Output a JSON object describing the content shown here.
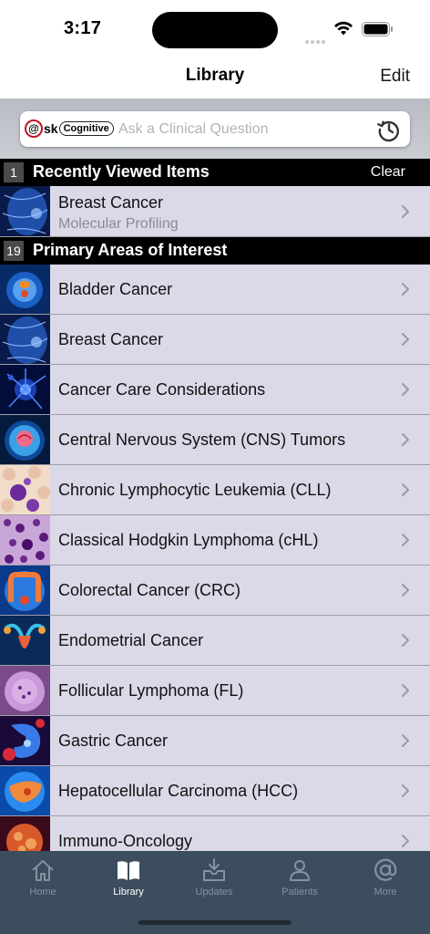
{
  "status_bar": {
    "time": "3:17"
  },
  "navbar": {
    "title": "Library",
    "edit_label": "Edit"
  },
  "search": {
    "logo_at": "@",
    "logo_sk": "sk",
    "logo_cognitive": "Cognitive",
    "placeholder": "Ask a Clinical Question",
    "history_icon": "history-clock-icon"
  },
  "recent": {
    "count": "1",
    "title": "Recently Viewed Items",
    "clear_label": "Clear",
    "items": [
      {
        "title": "Breast Cancer",
        "subtitle": "Molecular Profiling",
        "thumb": "breast-scan"
      }
    ]
  },
  "primary": {
    "count": "19",
    "title": "Primary Areas of Interest",
    "items": [
      {
        "title": "Bladder Cancer",
        "thumb": "bladder"
      },
      {
        "title": "Breast Cancer",
        "thumb": "breast-scan"
      },
      {
        "title": "Cancer Care Considerations",
        "thumb": "cell-burst"
      },
      {
        "title": "Central Nervous System (CNS) Tumors",
        "thumb": "brain"
      },
      {
        "title": "Chronic Lymphocytic Leukemia (CLL)",
        "thumb": "blood-cells"
      },
      {
        "title": "Classical Hodgkin Lymphoma (cHL)",
        "thumb": "tissue-purple"
      },
      {
        "title": "Colorectal Cancer (CRC)",
        "thumb": "colon"
      },
      {
        "title": "Endometrial Cancer",
        "thumb": "uterus"
      },
      {
        "title": "Follicular Lymphoma (FL)",
        "thumb": "follicle"
      },
      {
        "title": "Gastric Cancer",
        "thumb": "stomach"
      },
      {
        "title": "Hepatocellular Carcinoma (HCC)",
        "thumb": "liver"
      },
      {
        "title": "Immuno-Oncology",
        "thumb": "tumor"
      }
    ]
  },
  "tabbar": {
    "tabs": [
      {
        "label": "Home",
        "icon": "home-icon",
        "active": false
      },
      {
        "label": "Library",
        "icon": "book-icon",
        "active": true
      },
      {
        "label": "Updates",
        "icon": "inbox-download-icon",
        "active": false
      },
      {
        "label": "Patients",
        "icon": "person-icon",
        "active": false
      },
      {
        "label": "More",
        "icon": "at-sign-icon",
        "active": false
      }
    ]
  },
  "colors": {
    "row_background": "#dbd9e8",
    "section_header": "#000000",
    "tabbar_background": "#3c4e5d",
    "tab_inactive": "#8293a2",
    "tab_active": "#ffffff",
    "logo_red": "#c0142a"
  }
}
